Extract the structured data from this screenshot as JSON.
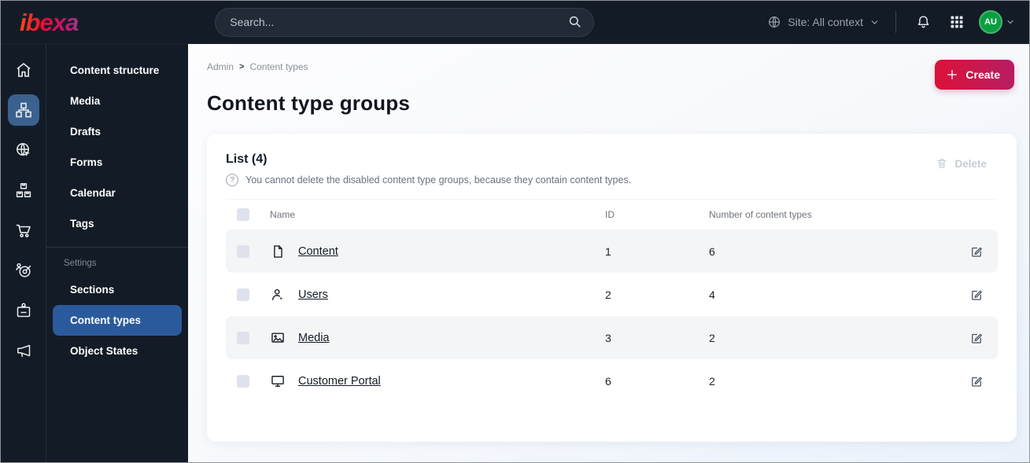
{
  "topbar": {
    "logo": "ibexa",
    "search_placeholder": "Search...",
    "site_context_label": "Site: All context",
    "avatar_initials": "AU"
  },
  "sidebar": {
    "rail_icons": [
      "home-icon",
      "sitemap-icon",
      "globe-pointer-icon",
      "product-catalog-icon",
      "cart-icon",
      "target-audience-icon",
      "admin-badge-icon",
      "megaphone-icon"
    ],
    "rail_active": "sitemap-icon",
    "menu": {
      "items": [
        "Content structure",
        "Media",
        "Drafts",
        "Forms",
        "Calendar",
        "Tags"
      ],
      "section_label": "Settings",
      "settings_items": [
        "Sections",
        "Content types",
        "Object States"
      ],
      "active_item": "Content types"
    }
  },
  "main": {
    "breadcrumb": {
      "items": [
        "Admin",
        "Content types"
      ],
      "separator": ">"
    },
    "create_button_label": "Create",
    "page_title": "Content type groups",
    "card": {
      "list_title": "List (4)",
      "help_glyph": "?",
      "info_text": "You cannot delete the disabled content type groups, because they contain content types.",
      "delete_button_label": "Delete",
      "table": {
        "headers": [
          "Name",
          "ID",
          "Number of content types"
        ],
        "rows": [
          {
            "icon": "file-icon",
            "name": "Content",
            "id": "1",
            "count": "6"
          },
          {
            "icon": "user-icon",
            "name": "Users",
            "id": "2",
            "count": "4"
          },
          {
            "icon": "image-icon",
            "name": "Media",
            "id": "3",
            "count": "2"
          },
          {
            "icon": "monitor-icon",
            "name": "Customer Portal",
            "id": "6",
            "count": "2"
          }
        ]
      }
    }
  },
  "colors": {
    "topbar_bg": "#131c26",
    "active_blue": "#2b5a9c",
    "rail_active_blue": "#3a618f",
    "brand_gradient_start": "#db1238",
    "brand_gradient_end": "#b81d63",
    "avatar_green": "#0b9e41",
    "row_shade": "#f4f5f7",
    "link_text": "#131c26",
    "muted_text": "#6b7280"
  }
}
